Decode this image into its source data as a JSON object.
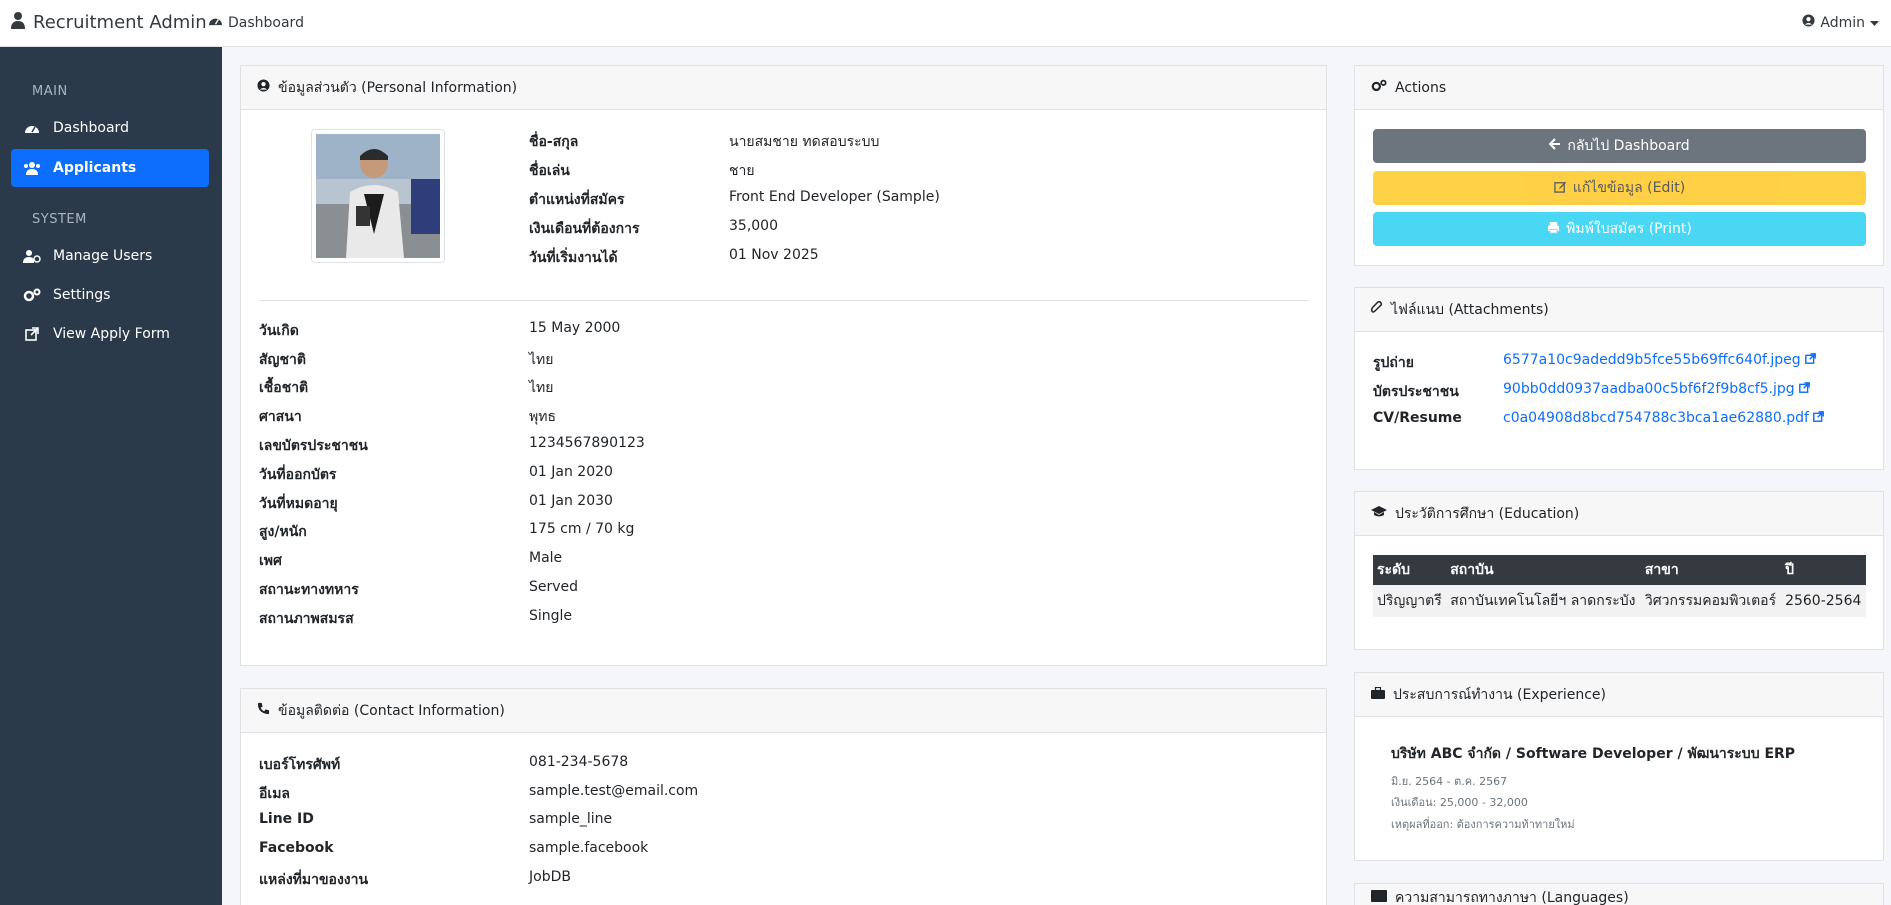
{
  "topbar": {
    "brand": "Recruitment Admin",
    "dashboard_link": "Dashboard",
    "user_menu": "Admin"
  },
  "sidebar": {
    "section_main": "MAIN",
    "section_system": "SYSTEM",
    "items": [
      {
        "label": "Dashboard",
        "icon": "gauge-icon"
      },
      {
        "label": "Applicants",
        "icon": "users-icon",
        "active": true
      },
      {
        "label": "Manage Users",
        "icon": "user-cog-icon"
      },
      {
        "label": "Settings",
        "icon": "gears-icon"
      },
      {
        "label": "View Apply Form",
        "icon": "external-link-icon"
      }
    ]
  },
  "personal": {
    "title": "ข้อมูลส่วนตัว (Personal Information)",
    "top": [
      {
        "label": "ชื่อ-สกุล",
        "value": "นายสมชาย ทดสอบระบบ"
      },
      {
        "label": "ชื่อเล่น",
        "value": "ชาย"
      },
      {
        "label": "ตำแหน่งที่สมัคร",
        "value": "Front End Developer (Sample)"
      },
      {
        "label": "เงินเดือนที่ต้องการ",
        "value": "35,000"
      },
      {
        "label": "วันที่เริ่มงานได้",
        "value": "01 Nov 2025"
      }
    ],
    "details": [
      {
        "label": "วันเกิด",
        "value": "15 May 2000"
      },
      {
        "label": "สัญชาติ",
        "value": "ไทย"
      },
      {
        "label": "เชื้อชาติ",
        "value": "ไทย"
      },
      {
        "label": "ศาสนา",
        "value": "พุทธ"
      },
      {
        "label": "เลขบัตรประชาชน",
        "value": "1234567890123"
      },
      {
        "label": "วันที่ออกบัตร",
        "value": "01 Jan 2020"
      },
      {
        "label": "วันที่หมดอายุ",
        "value": "01 Jan 2030"
      },
      {
        "label": "สูง/หนัก",
        "value": "175 cm / 70 kg"
      },
      {
        "label": "เพศ",
        "value": "Male"
      },
      {
        "label": "สถานะทางทหาร",
        "value": "Served"
      },
      {
        "label": "สถานภาพสมรส",
        "value": "Single"
      }
    ]
  },
  "contact": {
    "title": "ข้อมูลติดต่อ (Contact Information)",
    "rows": [
      {
        "label": "เบอร์โทรศัพท์",
        "value": "081-234-5678"
      },
      {
        "label": "อีเมล",
        "value": "sample.test@email.com"
      },
      {
        "label": "Line ID",
        "value": "sample_line"
      },
      {
        "label": "Facebook",
        "value": "sample.facebook"
      },
      {
        "label": "แหล่งที่มาของงาน",
        "value": "JobDB"
      }
    ]
  },
  "actions": {
    "title": "Actions",
    "back": "กลับไป Dashboard",
    "edit": "แก้ไขข้อมูล (Edit)",
    "print": "พิมพ์ใบสมัคร (Print)"
  },
  "attachments": {
    "title": "ไฟล์แนบ (Attachments)",
    "rows": [
      {
        "label": "รูปถ่าย",
        "file": "6577a10c9adedd9b5fce55b69ffc640f.jpeg"
      },
      {
        "label": "บัตรประชาชน",
        "file": "90bb0dd0937aadba00c5bf6f2f9b8cf5.jpg"
      },
      {
        "label": "CV/Resume",
        "file": "c0a04908d8bcd754788c3bca1ae62880.pdf"
      }
    ]
  },
  "education": {
    "title": "ประวัติการศึกษา (Education)",
    "headers": [
      "ระดับ",
      "สถาบัน",
      "สาขา",
      "ปี"
    ],
    "rows": [
      [
        "ปริญญาตรี",
        "สถาบันเทคโนโลยีฯ ลาดกระบัง",
        "วิศวกรรมคอมพิวเตอร์",
        "2560-2564"
      ]
    ]
  },
  "experience": {
    "title": "ประสบการณ์ทำงาน (Experience)",
    "job": "บริษัท ABC จำกัด / Software Developer / พัฒนาระบบ ERP",
    "period": "มิ.ย. 2564 - ต.ค. 2567",
    "salary": "เงินเดือน: 25,000 - 32,000",
    "reason": "เหตุผลที่ออก: ต้องการความท้าทายใหม่"
  },
  "languages": {
    "title": "ความสามารถทางภาษา (Languages)"
  },
  "colors": {
    "sidebar": "#2b3a4a",
    "active": "#0d6efd",
    "link": "#0d6efd"
  }
}
